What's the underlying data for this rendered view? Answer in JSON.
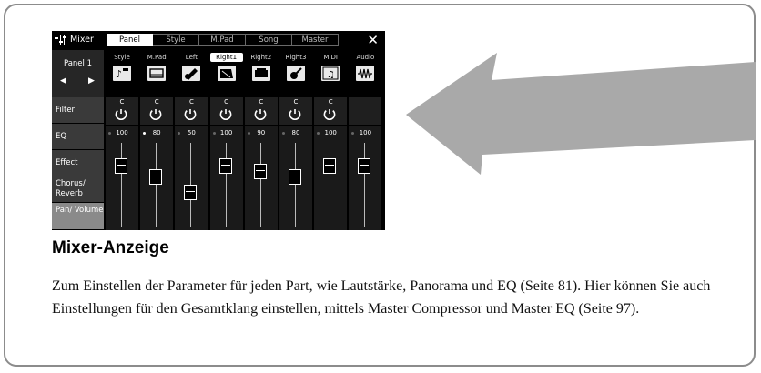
{
  "header": {
    "app_title": "Mixer",
    "tabs": [
      {
        "label": "Panel",
        "active": true
      },
      {
        "label": "Style",
        "active": false
      },
      {
        "label": "M.Pad",
        "active": false
      },
      {
        "label": "Song",
        "active": false
      },
      {
        "label": "Master",
        "active": false
      }
    ],
    "close_icon": "close-icon"
  },
  "panel_select": {
    "label": "Panel 1",
    "prev_icon": "triangle-left-icon",
    "next_icon": "triangle-right-icon"
  },
  "sidebar": {
    "items": [
      {
        "label": "Filter",
        "active": false
      },
      {
        "label": "EQ",
        "active": false
      },
      {
        "label": "Effect",
        "active": false
      },
      {
        "label": "Chorus/ Reverb",
        "active": false
      },
      {
        "label": "Pan/ Volume",
        "active": true
      }
    ]
  },
  "channels": [
    {
      "name": "Style",
      "icon": "style-icon",
      "pan": "C",
      "volume": "100",
      "fader_level": 0.78,
      "selected": false
    },
    {
      "name": "M.Pad",
      "icon": "pad-icon",
      "pan": "C",
      "volume": "80",
      "fader_level": 0.62,
      "selected": false
    },
    {
      "name": "Left",
      "icon": "strings-icon",
      "pan": "C",
      "volume": "50",
      "fader_level": 0.39,
      "selected": false
    },
    {
      "name": "Right1",
      "icon": "piano-icon",
      "pan": "C",
      "volume": "100",
      "fader_level": 0.78,
      "selected": true
    },
    {
      "name": "Right2",
      "icon": "keyboard-icon",
      "pan": "C",
      "volume": "90",
      "fader_level": 0.7,
      "selected": false
    },
    {
      "name": "Right3",
      "icon": "guitar-icon",
      "pan": "C",
      "volume": "80",
      "fader_level": 0.62,
      "selected": false
    },
    {
      "name": "MIDI",
      "icon": "note-icon",
      "pan": "C",
      "volume": "100",
      "fader_level": 0.78,
      "selected": false
    },
    {
      "name": "Audio",
      "icon": "waveform-icon",
      "pan": "",
      "volume": "100",
      "fader_level": 0.78,
      "selected": false
    }
  ],
  "caption": {
    "title": "Mixer-Anzeige",
    "text": "Zum Einstellen der Parameter für jeden Part, wie Lautstärke, Panorama und EQ (Seite 81). Hier können Sie auch Einstellungen für den Gesamtklang einstellen, mittels Master Compressor und Master EQ (Seite 97)."
  },
  "colors": {
    "screen_bg": "#000000",
    "arrow": "#a9a9a9",
    "frame_border": "#8c8c8c"
  }
}
